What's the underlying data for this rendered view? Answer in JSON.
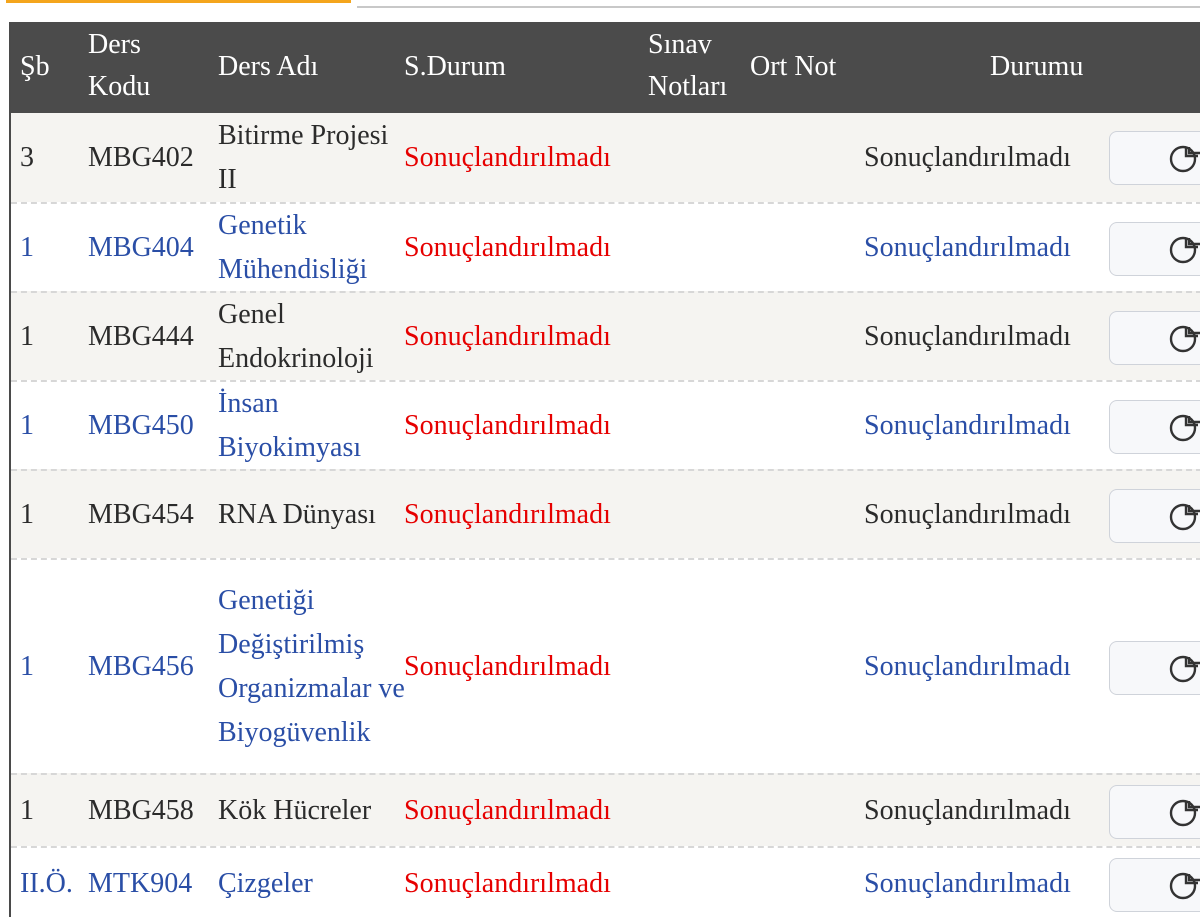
{
  "header": {
    "sb": "Şb",
    "ders_kodu": "Ders Kodu",
    "ders_adi": "Ders Adı",
    "s_durum": "S.Durum",
    "sinav_notlari": "Sınav Notları",
    "ort_not": "Ort Not",
    "durumu": "Durumu"
  },
  "rows": [
    {
      "sb": "3",
      "code": "MBG402",
      "name": "Bitirme Projesi II",
      "s_durum": "Sonuçlandırılmadı",
      "durumu": "Sonuçlandırılmadı",
      "color": "black",
      "button_icon": "chart-icon"
    },
    {
      "sb": "1",
      "code": "MBG404",
      "name": "Genetik Mühendisliği",
      "s_durum": "Sonuçlandırılmadı",
      "durumu": "Sonuçlandırılmadı",
      "color": "blue",
      "button_icon": "chart-icon"
    },
    {
      "sb": "1",
      "code": "MBG444",
      "name": "Genel Endokrinoloji",
      "s_durum": "Sonuçlandırılmadı",
      "durumu": "Sonuçlandırılmadı",
      "color": "black",
      "button_icon": "chart-icon"
    },
    {
      "sb": "1",
      "code": "MBG450",
      "name": "İnsan Biyokimyası",
      "s_durum": "Sonuçlandırılmadı",
      "durumu": "Sonuçlandırılmadı",
      "color": "blue",
      "button_icon": "chart-icon"
    },
    {
      "sb": "1",
      "code": "MBG454",
      "name": "RNA Dünyası",
      "s_durum": "Sonuçlandırılmadı",
      "durumu": "Sonuçlandırılmadı",
      "color": "black",
      "button_icon": "chart-icon"
    },
    {
      "sb": "1",
      "code": "MBG456",
      "name": "Genetiği Değiştirilmiş Organizmalar ve Biyogüvenlik",
      "s_durum": "Sonuçlandırılmadı",
      "durumu": "Sonuçlandırılmadı",
      "color": "blue",
      "button_icon": "chart-icon"
    },
    {
      "sb": "1",
      "code": "MBG458",
      "name": "Kök Hücreler",
      "s_durum": "Sonuçlandırılmadı",
      "durumu": "Sonuçlandırılmadı",
      "color": "black",
      "button_icon": "chart-icon"
    },
    {
      "sb": "II.Ö.",
      "code": "MTK904",
      "name": "Çizgeler",
      "s_durum": "Sonuçlandırılmadı",
      "durumu": "Sonuçlandırılmadı",
      "color": "blue",
      "button_icon": "chart-icon"
    }
  ],
  "colors": {
    "header_bg": "#4b4b4b",
    "link_blue": "#2a4ea6",
    "status_red": "#e60000",
    "row_alt": "#f5f4f1",
    "tab_accent": "#f4a51c"
  }
}
